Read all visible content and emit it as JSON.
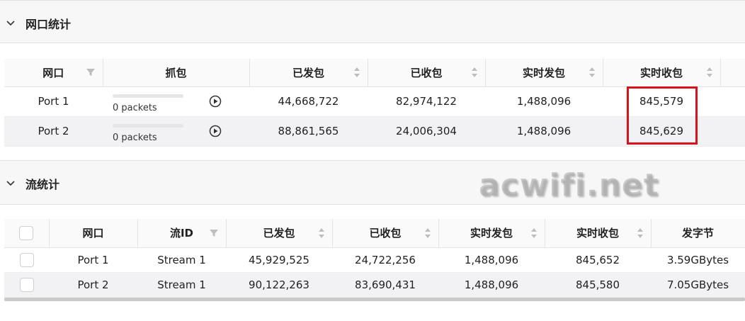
{
  "port_section": {
    "title": "网口统计",
    "columns": [
      "网口",
      "抓包",
      "已发包",
      "已收包",
      "实时发包",
      "实时收包"
    ],
    "rows": [
      {
        "port": "Port 1",
        "capture_text": "0 packets",
        "capture_progress": 0,
        "sent": "44,668,722",
        "received": "82,974,122",
        "rt_sent": "1,488,096",
        "rt_received": "845,579"
      },
      {
        "port": "Port 2",
        "capture_text": "0 packets",
        "capture_progress": 0,
        "sent": "88,861,565",
        "received": "24,006,304",
        "rt_sent": "1,488,096",
        "rt_received": "845,629"
      }
    ]
  },
  "stream_section": {
    "title": "流统计",
    "columns": [
      "网口",
      "流ID",
      "已发包",
      "已收包",
      "实时发包",
      "实时收包",
      "发字节"
    ],
    "rows": [
      {
        "port": "Port 1",
        "stream": "Stream 1",
        "sent": "45,929,525",
        "received": "24,722,256",
        "rt_sent": "1,488,096",
        "rt_received": "845,652",
        "bytes": "3.59GBytes"
      },
      {
        "port": "Port 2",
        "stream": "Stream 1",
        "sent": "90,122,263",
        "received": "83,690,431",
        "rt_sent": "1,488,096",
        "rt_received": "845,580",
        "bytes": "7.05GBytes"
      }
    ]
  },
  "watermark": "acwifi.net",
  "colors": {
    "highlight": "#d9131b",
    "row_alt": "#f2f2f4",
    "header_bg": "#f7f7f7"
  },
  "icons": {
    "collapse": "chevron-down-icon",
    "filter": "filter-icon",
    "sort": "sort-icon",
    "capture": "play-circle-icon",
    "select": "checkbox"
  }
}
